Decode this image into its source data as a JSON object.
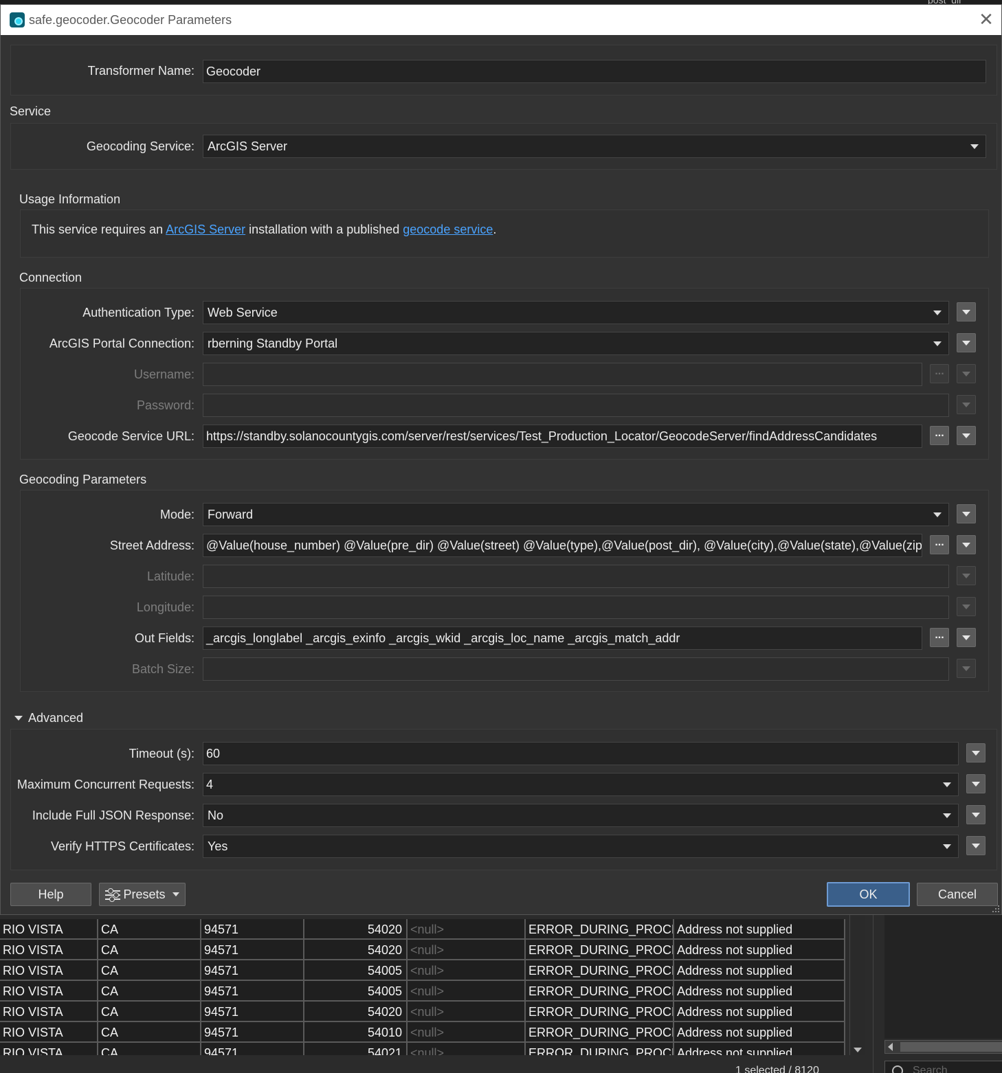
{
  "window": {
    "title": "safe.geocoder.Geocoder Parameters"
  },
  "background": {
    "top_tab_text": "post_dir"
  },
  "transformer": {
    "label": "Transformer Name:",
    "value": "Geocoder"
  },
  "service": {
    "section_label": "Service",
    "geocoding_service_label": "Geocoding Service:",
    "geocoding_service_value": "ArcGIS Server"
  },
  "usage": {
    "section_label": "Usage Information",
    "text_before": "This service requires an ",
    "link1": "ArcGIS Server",
    "text_middle": " installation with a published ",
    "link2": "geocode service",
    "text_after": "."
  },
  "connection": {
    "section_label": "Connection",
    "auth_label": "Authentication Type:",
    "auth_value": "Web Service",
    "portal_label": "ArcGIS Portal Connection:",
    "portal_value": "rberning Standby Portal",
    "username_label": "Username:",
    "username_value": "",
    "password_label": "Password:",
    "password_value": "",
    "url_label": "Geocode Service URL:",
    "url_value": "https://standby.solanocountygis.com/server/rest/services/Test_Production_Locator/GeocodeServer/findAddressCandidates"
  },
  "geocoding_params": {
    "section_label": "Geocoding Parameters",
    "mode_label": "Mode:",
    "mode_value": "Forward",
    "street_label": "Street Address:",
    "street_value": "@Value(house_number) @Value(pre_dir) @Value(street) @Value(type),@Value(post_dir), @Value(city),@Value(state),@Value(zip)",
    "lat_label": "Latitude:",
    "lat_value": "",
    "lon_label": "Longitude:",
    "lon_value": "",
    "outfields_label": "Out Fields:",
    "outfields_value": "_arcgis_longlabel _arcgis_exinfo _arcgis_wkid _arcgis_loc_name _arcgis_match_addr",
    "batch_label": "Batch Size:",
    "batch_value": ""
  },
  "advanced": {
    "toggle_label": "Advanced",
    "timeout_label": "Timeout (s):",
    "timeout_value": "60",
    "max_conc_label": "Maximum Concurrent Requests:",
    "max_conc_value": "4",
    "full_json_label": "Include Full JSON Response:",
    "full_json_value": "No",
    "verify_https_label": "Verify HTTPS Certificates:",
    "verify_https_value": "Yes"
  },
  "buttons": {
    "help": "Help",
    "presets": "Presets",
    "ok": "OK",
    "cancel": "Cancel"
  },
  "table": {
    "rows": [
      [
        "RIO VISTA",
        "CA",
        "94571",
        "54020",
        "<null>",
        "ERROR_DURING_PROCE...",
        "Address not supplied"
      ],
      [
        "RIO VISTA",
        "CA",
        "94571",
        "54020",
        "<null>",
        "ERROR_DURING_PROCE...",
        "Address not supplied"
      ],
      [
        "RIO VISTA",
        "CA",
        "94571",
        "54005",
        "<null>",
        "ERROR_DURING_PROCE...",
        "Address not supplied"
      ],
      [
        "RIO VISTA",
        "CA",
        "94571",
        "54005",
        "<null>",
        "ERROR_DURING_PROCE...",
        "Address not supplied"
      ],
      [
        "RIO VISTA",
        "CA",
        "94571",
        "54020",
        "<null>",
        "ERROR_DURING_PROCE...",
        "Address not supplied"
      ],
      [
        "RIO VISTA",
        "CA",
        "94571",
        "54010",
        "<null>",
        "ERROR_DURING_PROCE...",
        "Address not supplied"
      ],
      [
        "RIO VISTA",
        "CA",
        "94571",
        "54021",
        "<null>",
        "ERROR_DURING_PROCE...",
        "Address not supplied"
      ]
    ]
  },
  "side_panel": {
    "search_placeholder": "Search"
  },
  "status": {
    "text": "1 selected / 8120"
  }
}
